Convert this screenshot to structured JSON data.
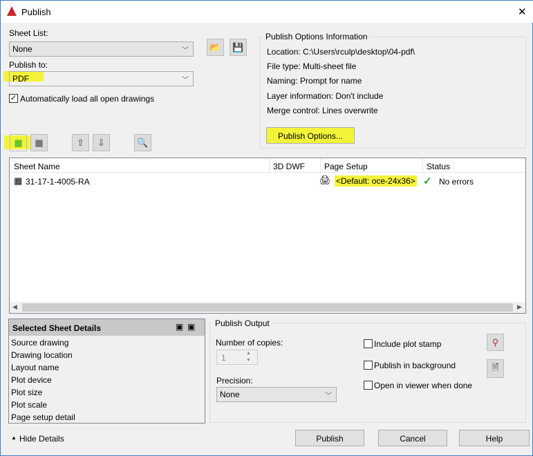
{
  "window": {
    "title": "Publish",
    "close": "✕"
  },
  "sheet_list": {
    "label": "Sheet List:",
    "value": "None"
  },
  "publish_to": {
    "label": "Publish to:",
    "value": "PDF"
  },
  "auto_load": {
    "label": "Automatically load all open drawings",
    "checked": true
  },
  "options_info": {
    "title": "Publish Options Information",
    "lines": [
      "Location: C:\\Users\\rculp\\desktop\\04-pdf\\",
      "File type: Multi-sheet file",
      "Naming: Prompt for name",
      "Layer information: Don't include",
      "Merge control: Lines overwrite"
    ],
    "button": "Publish Options..."
  },
  "table": {
    "headers": [
      "Sheet Name",
      "3D DWF",
      "Page Setup",
      "Status"
    ],
    "rows": [
      {
        "sheet": "31-17-1-4005-RA",
        "dwf": "",
        "page_setup": "<Default: oce-24x36>",
        "status": "No errors"
      }
    ]
  },
  "details": {
    "title": "Selected Sheet Details",
    "items": [
      "Source drawing",
      "Drawing location",
      "Layout name",
      "Plot device",
      "Plot size",
      "Plot scale",
      "Page setup detail"
    ]
  },
  "output": {
    "title": "Publish Output",
    "copies_label": "Number of copies:",
    "copies": "1",
    "precision_label": "Precision:",
    "precision": "None",
    "checks": [
      {
        "label": "Include plot stamp",
        "checked": false
      },
      {
        "label": "Publish in background",
        "checked": false
      },
      {
        "label": "Open in viewer when done",
        "checked": false
      }
    ]
  },
  "footer": {
    "hide_details": "Hide Details",
    "publish": "Publish",
    "cancel": "Cancel",
    "help": "Help"
  },
  "colors": {
    "highlight": "#f3f33a",
    "autocad_red": "#c8282d",
    "check_green": "#2aa52a"
  }
}
